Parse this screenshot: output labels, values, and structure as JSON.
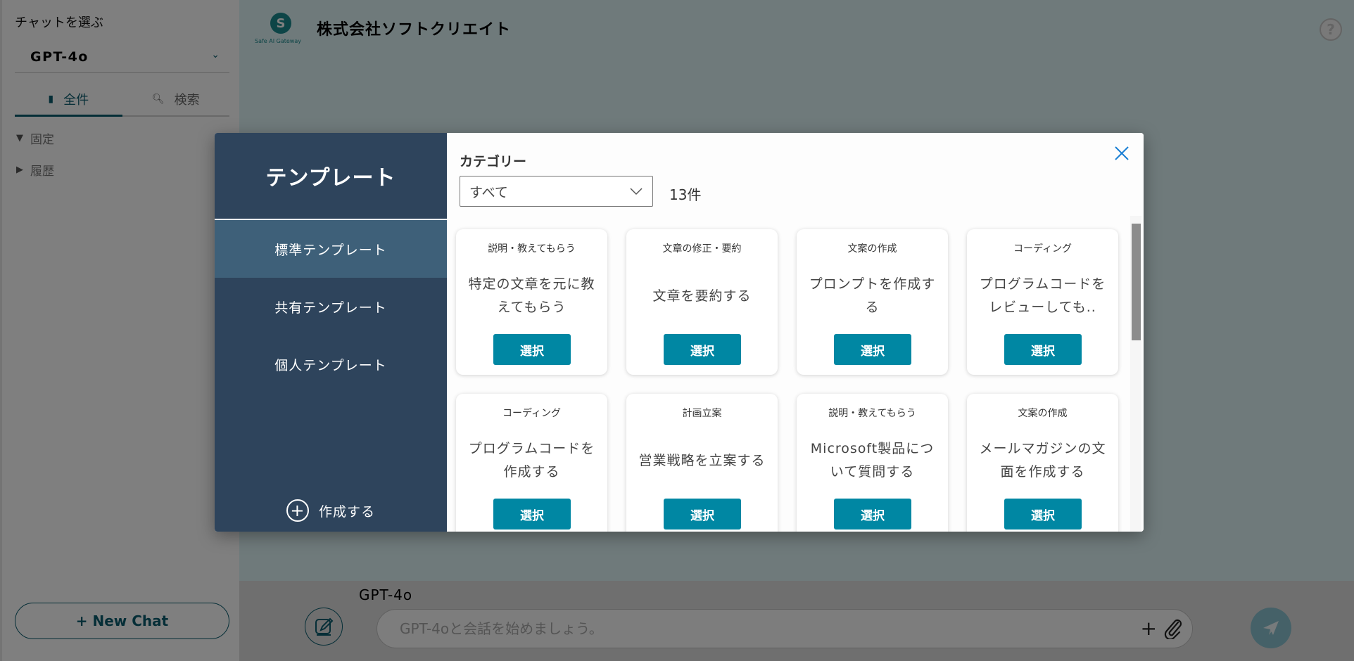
{
  "sidebar": {
    "choose_label": "チャットを選ぶ",
    "model_selected": "GPT-4o",
    "tabs": [
      {
        "label": "全件",
        "icon": "copy-icon",
        "active": true
      },
      {
        "label": "検索",
        "icon": "search-icon",
        "active": false
      }
    ],
    "tree": [
      {
        "label": "固定",
        "expanded": true
      },
      {
        "label": "履歴",
        "expanded": false
      }
    ],
    "new_chat_label": "+ New Chat"
  },
  "header": {
    "logo_mark": "S",
    "logo_sub": "Safe AI Gateway",
    "company": "株式会社ソフトクリエイト",
    "help_icon": "?"
  },
  "composer": {
    "model_name": "GPT-4o",
    "placeholder": "GPT-4oと会話を始めましょう。",
    "plus": "+"
  },
  "modal": {
    "title": "テンプレート",
    "nav": [
      {
        "label": "標準テンプレート",
        "active": true
      },
      {
        "label": "共有テンプレート",
        "active": false
      },
      {
        "label": "個人テンプレート",
        "active": false
      }
    ],
    "create_label": "作成する",
    "category_label": "カテゴリー",
    "category_selected": "すべて",
    "count": "13件",
    "select_label": "選択",
    "cards": [
      {
        "category": "説明・教えてもらう",
        "description": "特定の文章を元に教えてもらう"
      },
      {
        "category": "文章の修正・要約",
        "description": "文章を要約する"
      },
      {
        "category": "文案の作成",
        "description": "プロンプトを作成する"
      },
      {
        "category": "コーディング",
        "description": "プログラムコードをレビューしても.."
      },
      {
        "category": "コーディング",
        "description": "プログラムコードを作成する"
      },
      {
        "category": "計画立案",
        "description": "営業戦略を立案する"
      },
      {
        "category": "説明・教えてもらう",
        "description": "Microsoft製品について質問する"
      },
      {
        "category": "文案の作成",
        "description": "メールマガジンの文面を作成する"
      }
    ]
  },
  "colors": {
    "brand": "#0b5c6e",
    "modal_nav": "#2e445c",
    "modal_nav_active": "#3e6079",
    "select_button": "#0087a3",
    "close_icon": "#1a7fd4"
  }
}
